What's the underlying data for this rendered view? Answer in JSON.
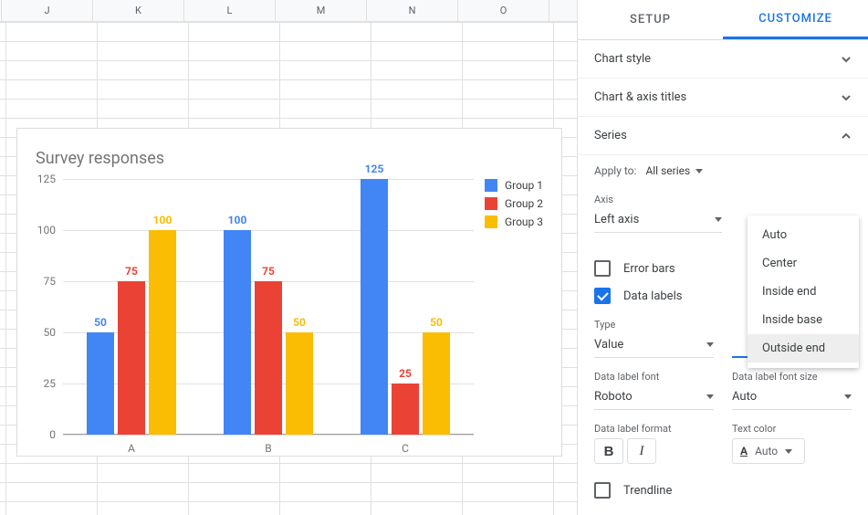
{
  "columns": [
    "J",
    "K",
    "L",
    "M",
    "N",
    "O"
  ],
  "chart_data": {
    "type": "bar",
    "title": "Survey responses",
    "categories": [
      "A",
      "B",
      "C"
    ],
    "series": [
      {
        "name": "Group 1",
        "color": "#4285f4",
        "values": [
          50,
          100,
          125
        ]
      },
      {
        "name": "Group 2",
        "color": "#ea4335",
        "values": [
          75,
          75,
          25
        ]
      },
      {
        "name": "Group 3",
        "color": "#fbbc04",
        "values": [
          100,
          50,
          50
        ]
      }
    ],
    "ylim": [
      0,
      125
    ],
    "yticks": [
      0,
      25,
      50,
      75,
      100,
      125
    ],
    "xlabel": "",
    "ylabel": ""
  },
  "sidebar": {
    "tab_setup": "SETUP",
    "tab_customize": "CUSTOMIZE",
    "sections": {
      "chart_style": "Chart style",
      "chart_axis_titles": "Chart & axis titles",
      "series": "Series"
    },
    "series": {
      "apply_to_label": "Apply to:",
      "apply_to_value": "All series",
      "axis_label": "Axis",
      "axis_value": "Left axis",
      "error_bars": "Error bars",
      "data_labels": "Data labels",
      "type_label": "Type",
      "type_value": "Value",
      "position_options": [
        "Auto",
        "Center",
        "Inside end",
        "Inside base",
        "Outside end"
      ],
      "font_label": "Data label font",
      "font_value": "Roboto",
      "fontsize_label": "Data label font size",
      "fontsize_value": "Auto",
      "format_label": "Data label format",
      "textcolor_label": "Text color",
      "textcolor_value": "Auto",
      "trendline": "Trendline"
    }
  }
}
